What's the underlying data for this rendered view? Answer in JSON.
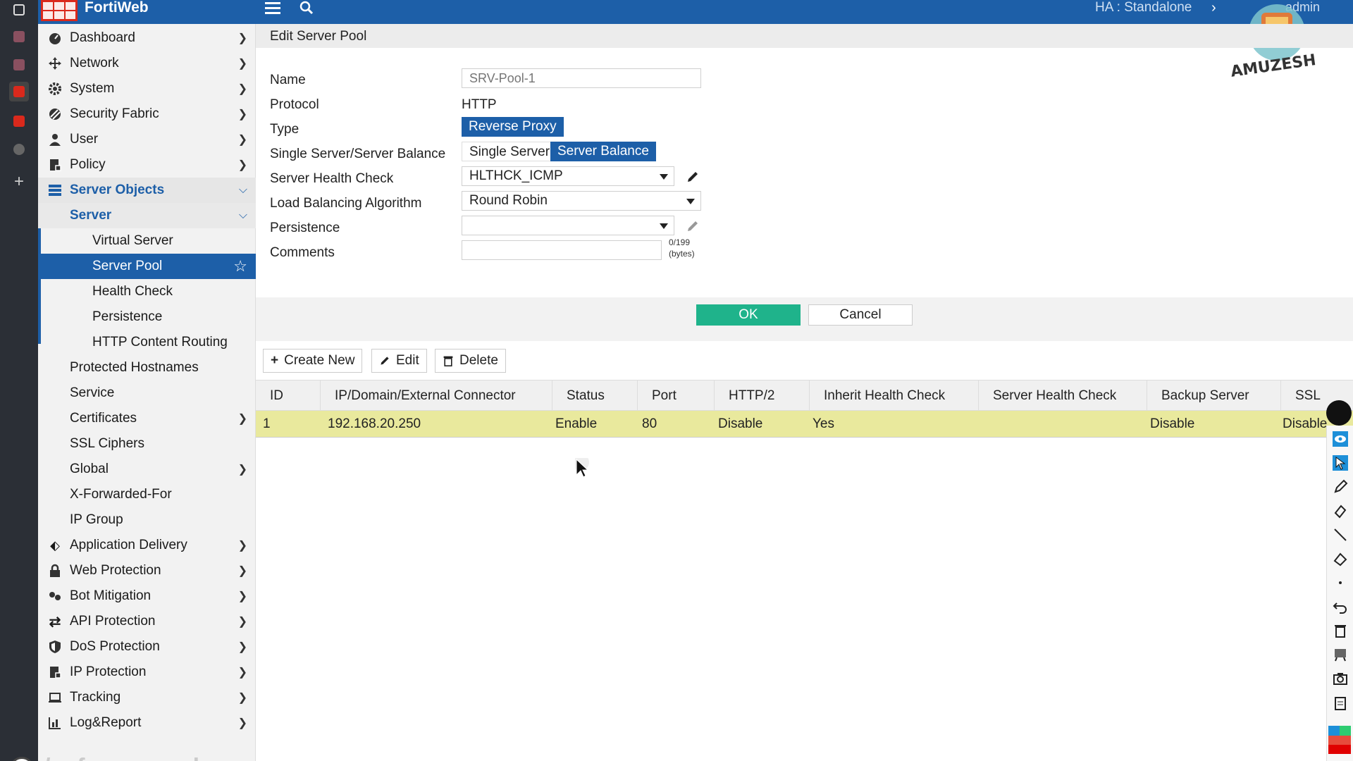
{
  "topbar": {
    "product": "FortiWeb",
    "ha_label": "HA :",
    "ha_value": "Standalone",
    "user": "admin"
  },
  "watermark": {
    "text": "AMUZESH"
  },
  "sidebar": {
    "items": [
      {
        "label": "Dashboard",
        "icon": "dashboard-icon"
      },
      {
        "label": "Network",
        "icon": "network-icon"
      },
      {
        "label": "System",
        "icon": "gear-icon"
      },
      {
        "label": "Security Fabric",
        "icon": "security-fabric-icon"
      },
      {
        "label": "User",
        "icon": "user-icon"
      },
      {
        "label": "Policy",
        "icon": "policy-icon"
      },
      {
        "label": "Server Objects",
        "icon": "server-objects-icon"
      },
      {
        "label": "Server"
      },
      {
        "label": "Virtual Server"
      },
      {
        "label": "Server Pool"
      },
      {
        "label": "Health Check"
      },
      {
        "label": "Persistence"
      },
      {
        "label": "HTTP Content Routing"
      },
      {
        "label": "Protected Hostnames"
      },
      {
        "label": "Service"
      },
      {
        "label": "Certificates"
      },
      {
        "label": "SSL Ciphers"
      },
      {
        "label": "Global"
      },
      {
        "label": "X-Forwarded-For"
      },
      {
        "label": "IP Group"
      },
      {
        "label": "Application Delivery",
        "icon": "application-delivery-icon"
      },
      {
        "label": "Web Protection",
        "icon": "lock-icon"
      },
      {
        "label": "Bot Mitigation",
        "icon": "bot-icon"
      },
      {
        "label": "API Protection",
        "icon": "api-icon"
      },
      {
        "label": "DoS Protection",
        "icon": "shield-icon"
      },
      {
        "label": "IP Protection",
        "icon": "ip-protection-icon"
      },
      {
        "label": "Tracking",
        "icon": "laptop-icon"
      },
      {
        "label": "Log&Report",
        "icon": "chart-icon"
      }
    ],
    "footer_text": "/cafe.amuzesh"
  },
  "form": {
    "title": "Edit Server Pool",
    "name_label": "Name",
    "name_placeholder": "SRV-Pool-1",
    "protocol_label": "Protocol",
    "protocol_value": "HTTP",
    "type_label": "Type",
    "type_value": "Reverse Proxy",
    "balance_label": "Single Server/Server Balance",
    "balance_single": "Single Server",
    "balance_multi": "Server Balance",
    "health_label": "Server Health Check",
    "health_value": "HLTHCK_ICMP",
    "algo_label": "Load Balancing Algorithm",
    "algo_value": "Round Robin",
    "persistence_label": "Persistence",
    "persistence_value": "",
    "comments_label": "Comments",
    "comments_counter": "0/199",
    "comments_unit": "(bytes)",
    "ok": "OK",
    "cancel": "Cancel"
  },
  "toolbar": {
    "create": "Create New",
    "edit": "Edit",
    "delete": "Delete"
  },
  "table": {
    "columns": [
      "ID",
      "IP/Domain/External Connector",
      "Status",
      "Port",
      "HTTP/2",
      "Inherit Health Check",
      "Server Health Check",
      "Backup Server",
      "SSL"
    ],
    "rows": [
      [
        "1",
        "192.168.20.250",
        "Enable",
        "80",
        "Disable",
        "Yes",
        "",
        "Disable",
        "Disable"
      ]
    ]
  },
  "colors": {
    "brand_blue": "#1d5fa8",
    "ok_green": "#1fb38b",
    "row_highlight": "#e9e99d",
    "forti_red": "#da291c"
  }
}
